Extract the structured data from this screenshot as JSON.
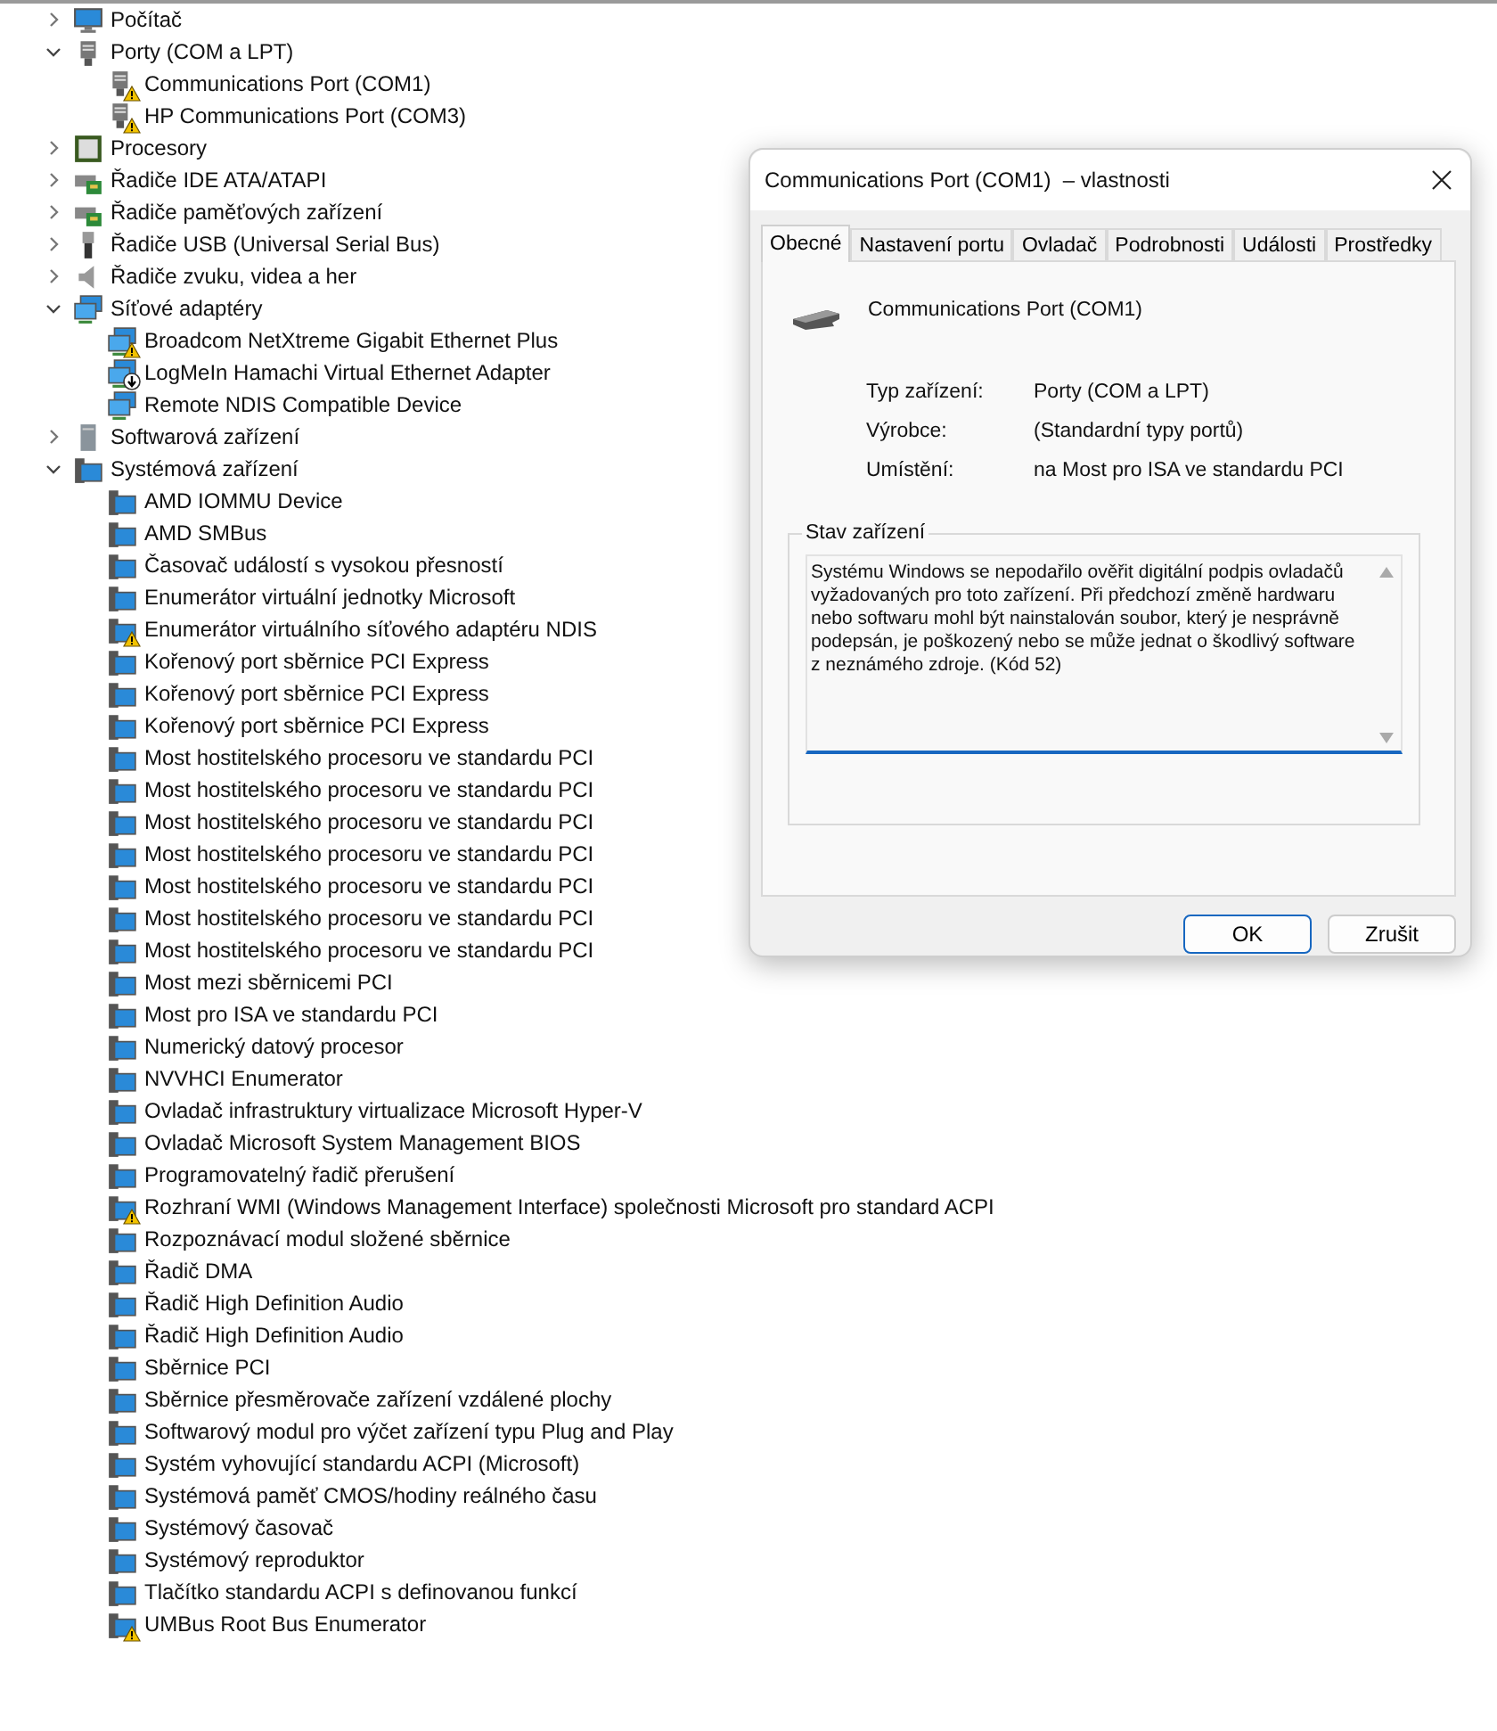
{
  "tree": [
    {
      "label": "Počítač",
      "kind": "computer",
      "expanded": false
    },
    {
      "label": "Porty (COM a LPT)",
      "kind": "port",
      "expanded": true,
      "children": [
        {
          "label": "Communications Port (COM1)",
          "kind": "port",
          "problem": true,
          "disabled": false
        },
        {
          "label": "HP Communications Port (COM3)",
          "kind": "port",
          "problem": true,
          "disabled": false
        }
      ]
    },
    {
      "label": "Procesory",
      "kind": "cpu",
      "expanded": false
    },
    {
      "label": "Řadiče IDE ATA/ATAPI",
      "kind": "ide",
      "expanded": false
    },
    {
      "label": "Řadiče paměťových zařízení",
      "kind": "storage",
      "expanded": false
    },
    {
      "label": "Řadiče USB (Universal Serial Bus)",
      "kind": "usb",
      "expanded": false
    },
    {
      "label": "Řadiče zvuku, videa a her",
      "kind": "sound",
      "expanded": false
    },
    {
      "label": "Síťové adaptéry",
      "kind": "network",
      "expanded": true,
      "children": [
        {
          "label": "Broadcom NetXtreme Gigabit Ethernet Plus",
          "kind": "network",
          "problem": true,
          "disabled": false
        },
        {
          "label": "LogMeIn Hamachi Virtual Ethernet Adapter",
          "kind": "network",
          "problem": false,
          "disabled": true
        },
        {
          "label": "Remote NDIS Compatible Device",
          "kind": "network",
          "problem": false,
          "disabled": false
        }
      ]
    },
    {
      "label": "Softwarová zařízení",
      "kind": "software",
      "expanded": false
    },
    {
      "label": "Systémová zařízení",
      "kind": "system",
      "expanded": true,
      "children": [
        {
          "label": "AMD IOMMU Device",
          "kind": "system",
          "problem": false,
          "disabled": false
        },
        {
          "label": "AMD SMBus",
          "kind": "system",
          "problem": false,
          "disabled": false
        },
        {
          "label": "Časovač událostí s vysokou přesností",
          "kind": "system",
          "problem": false,
          "disabled": false
        },
        {
          "label": "Enumerátor virtuální jednotky Microsoft",
          "kind": "system",
          "problem": false,
          "disabled": false
        },
        {
          "label": "Enumerátor virtuálního síťového adaptéru NDIS",
          "kind": "system",
          "problem": true,
          "disabled": false
        },
        {
          "label": "Kořenový port sběrnice PCI Express",
          "kind": "system",
          "problem": false,
          "disabled": false
        },
        {
          "label": "Kořenový port sběrnice PCI Express",
          "kind": "system",
          "problem": false,
          "disabled": false
        },
        {
          "label": "Kořenový port sběrnice PCI Express",
          "kind": "system",
          "problem": false,
          "disabled": false
        },
        {
          "label": "Most hostitelského procesoru ve standardu PCI",
          "kind": "system",
          "problem": false,
          "disabled": false
        },
        {
          "label": "Most hostitelského procesoru ve standardu PCI",
          "kind": "system",
          "problem": false,
          "disabled": false
        },
        {
          "label": "Most hostitelského procesoru ve standardu PCI",
          "kind": "system",
          "problem": false,
          "disabled": false
        },
        {
          "label": "Most hostitelského procesoru ve standardu PCI",
          "kind": "system",
          "problem": false,
          "disabled": false
        },
        {
          "label": "Most hostitelského procesoru ve standardu PCI",
          "kind": "system",
          "problem": false,
          "disabled": false
        },
        {
          "label": "Most hostitelského procesoru ve standardu PCI",
          "kind": "system",
          "problem": false,
          "disabled": false
        },
        {
          "label": "Most hostitelského procesoru ve standardu PCI",
          "kind": "system",
          "problem": false,
          "disabled": false
        },
        {
          "label": "Most mezi sběrnicemi PCI",
          "kind": "system",
          "problem": false,
          "disabled": false
        },
        {
          "label": "Most pro ISA ve standardu PCI",
          "kind": "system",
          "problem": false,
          "disabled": false
        },
        {
          "label": "Numerický datový procesor",
          "kind": "system",
          "problem": false,
          "disabled": false
        },
        {
          "label": "NVVHCI Enumerator",
          "kind": "system",
          "problem": false,
          "disabled": false
        },
        {
          "label": "Ovladač infrastruktury virtualizace Microsoft Hyper-V",
          "kind": "system",
          "problem": false,
          "disabled": false
        },
        {
          "label": "Ovladač Microsoft System Management BIOS",
          "kind": "system",
          "problem": false,
          "disabled": false
        },
        {
          "label": "Programovatelný řadič přerušení",
          "kind": "system",
          "problem": false,
          "disabled": false
        },
        {
          "label": "Rozhraní WMI (Windows Management Interface) společnosti Microsoft pro standard ACPI",
          "kind": "system",
          "problem": true,
          "disabled": false
        },
        {
          "label": "Rozpoznávací modul složené sběrnice",
          "kind": "system",
          "problem": false,
          "disabled": false
        },
        {
          "label": "Řadič DMA",
          "kind": "system",
          "problem": false,
          "disabled": false
        },
        {
          "label": "Řadič High Definition Audio",
          "kind": "system",
          "problem": false,
          "disabled": false
        },
        {
          "label": "Řadič High Definition Audio",
          "kind": "system",
          "problem": false,
          "disabled": false
        },
        {
          "label": "Sběrnice PCI",
          "kind": "system",
          "problem": false,
          "disabled": false
        },
        {
          "label": "Sběrnice přesměrovače zařízení vzdálené plochy",
          "kind": "system",
          "problem": false,
          "disabled": false
        },
        {
          "label": "Softwarový modul pro výčet zařízení typu Plug and Play",
          "kind": "system",
          "problem": false,
          "disabled": false
        },
        {
          "label": "Systém vyhovující standardu ACPI (Microsoft)",
          "kind": "system",
          "problem": false,
          "disabled": false
        },
        {
          "label": "Systémová paměť CMOS/hodiny reálného času",
          "kind": "system",
          "problem": false,
          "disabled": false
        },
        {
          "label": "Systémový časovač",
          "kind": "system",
          "problem": false,
          "disabled": false
        },
        {
          "label": "Systémový reproduktor",
          "kind": "system",
          "problem": false,
          "disabled": false
        },
        {
          "label": "Tlačítko standardu ACPI s definovanou funkcí",
          "kind": "system",
          "problem": false,
          "disabled": false
        },
        {
          "label": "UMBus Root Bus Enumerator",
          "kind": "system",
          "problem": true,
          "disabled": false
        }
      ]
    }
  ],
  "dialog": {
    "title": "Communications Port (COM1)  – vlastnosti",
    "tabs": [
      {
        "label": "Obecné",
        "selected": true
      },
      {
        "label": "Nastavení portu",
        "selected": false
      },
      {
        "label": "Ovladač",
        "selected": false
      },
      {
        "label": "Podrobnosti",
        "selected": false
      },
      {
        "label": "Události",
        "selected": false
      },
      {
        "label": "Prostředky",
        "selected": false
      }
    ],
    "device_name": "Communications Port (COM1)",
    "properties": [
      {
        "label": "Typ zařízení:",
        "value": "Porty (COM a LPT)"
      },
      {
        "label": "Výrobce:",
        "value": "(Standardní typy portů)"
      },
      {
        "label": "Umístění:",
        "value": "na Most pro ISA ve standardu PCI"
      }
    ],
    "status": {
      "title": "Stav zařízení",
      "value": "Systému Windows se nepodařilo ověřit digitální podpis ovladačů vyžadovaných pro toto zařízení. Při předchozí změně hardwaru nebo softwaru mohl být nainstalován soubor, který je nesprávně podepsán, je poškozený nebo se může jednat o škodlivý software z neznámého zdroje. (Kód 52)"
    },
    "buttons": [
      {
        "label": "OK",
        "default": true
      },
      {
        "label": "Zrušit",
        "default": false
      }
    ]
  }
}
